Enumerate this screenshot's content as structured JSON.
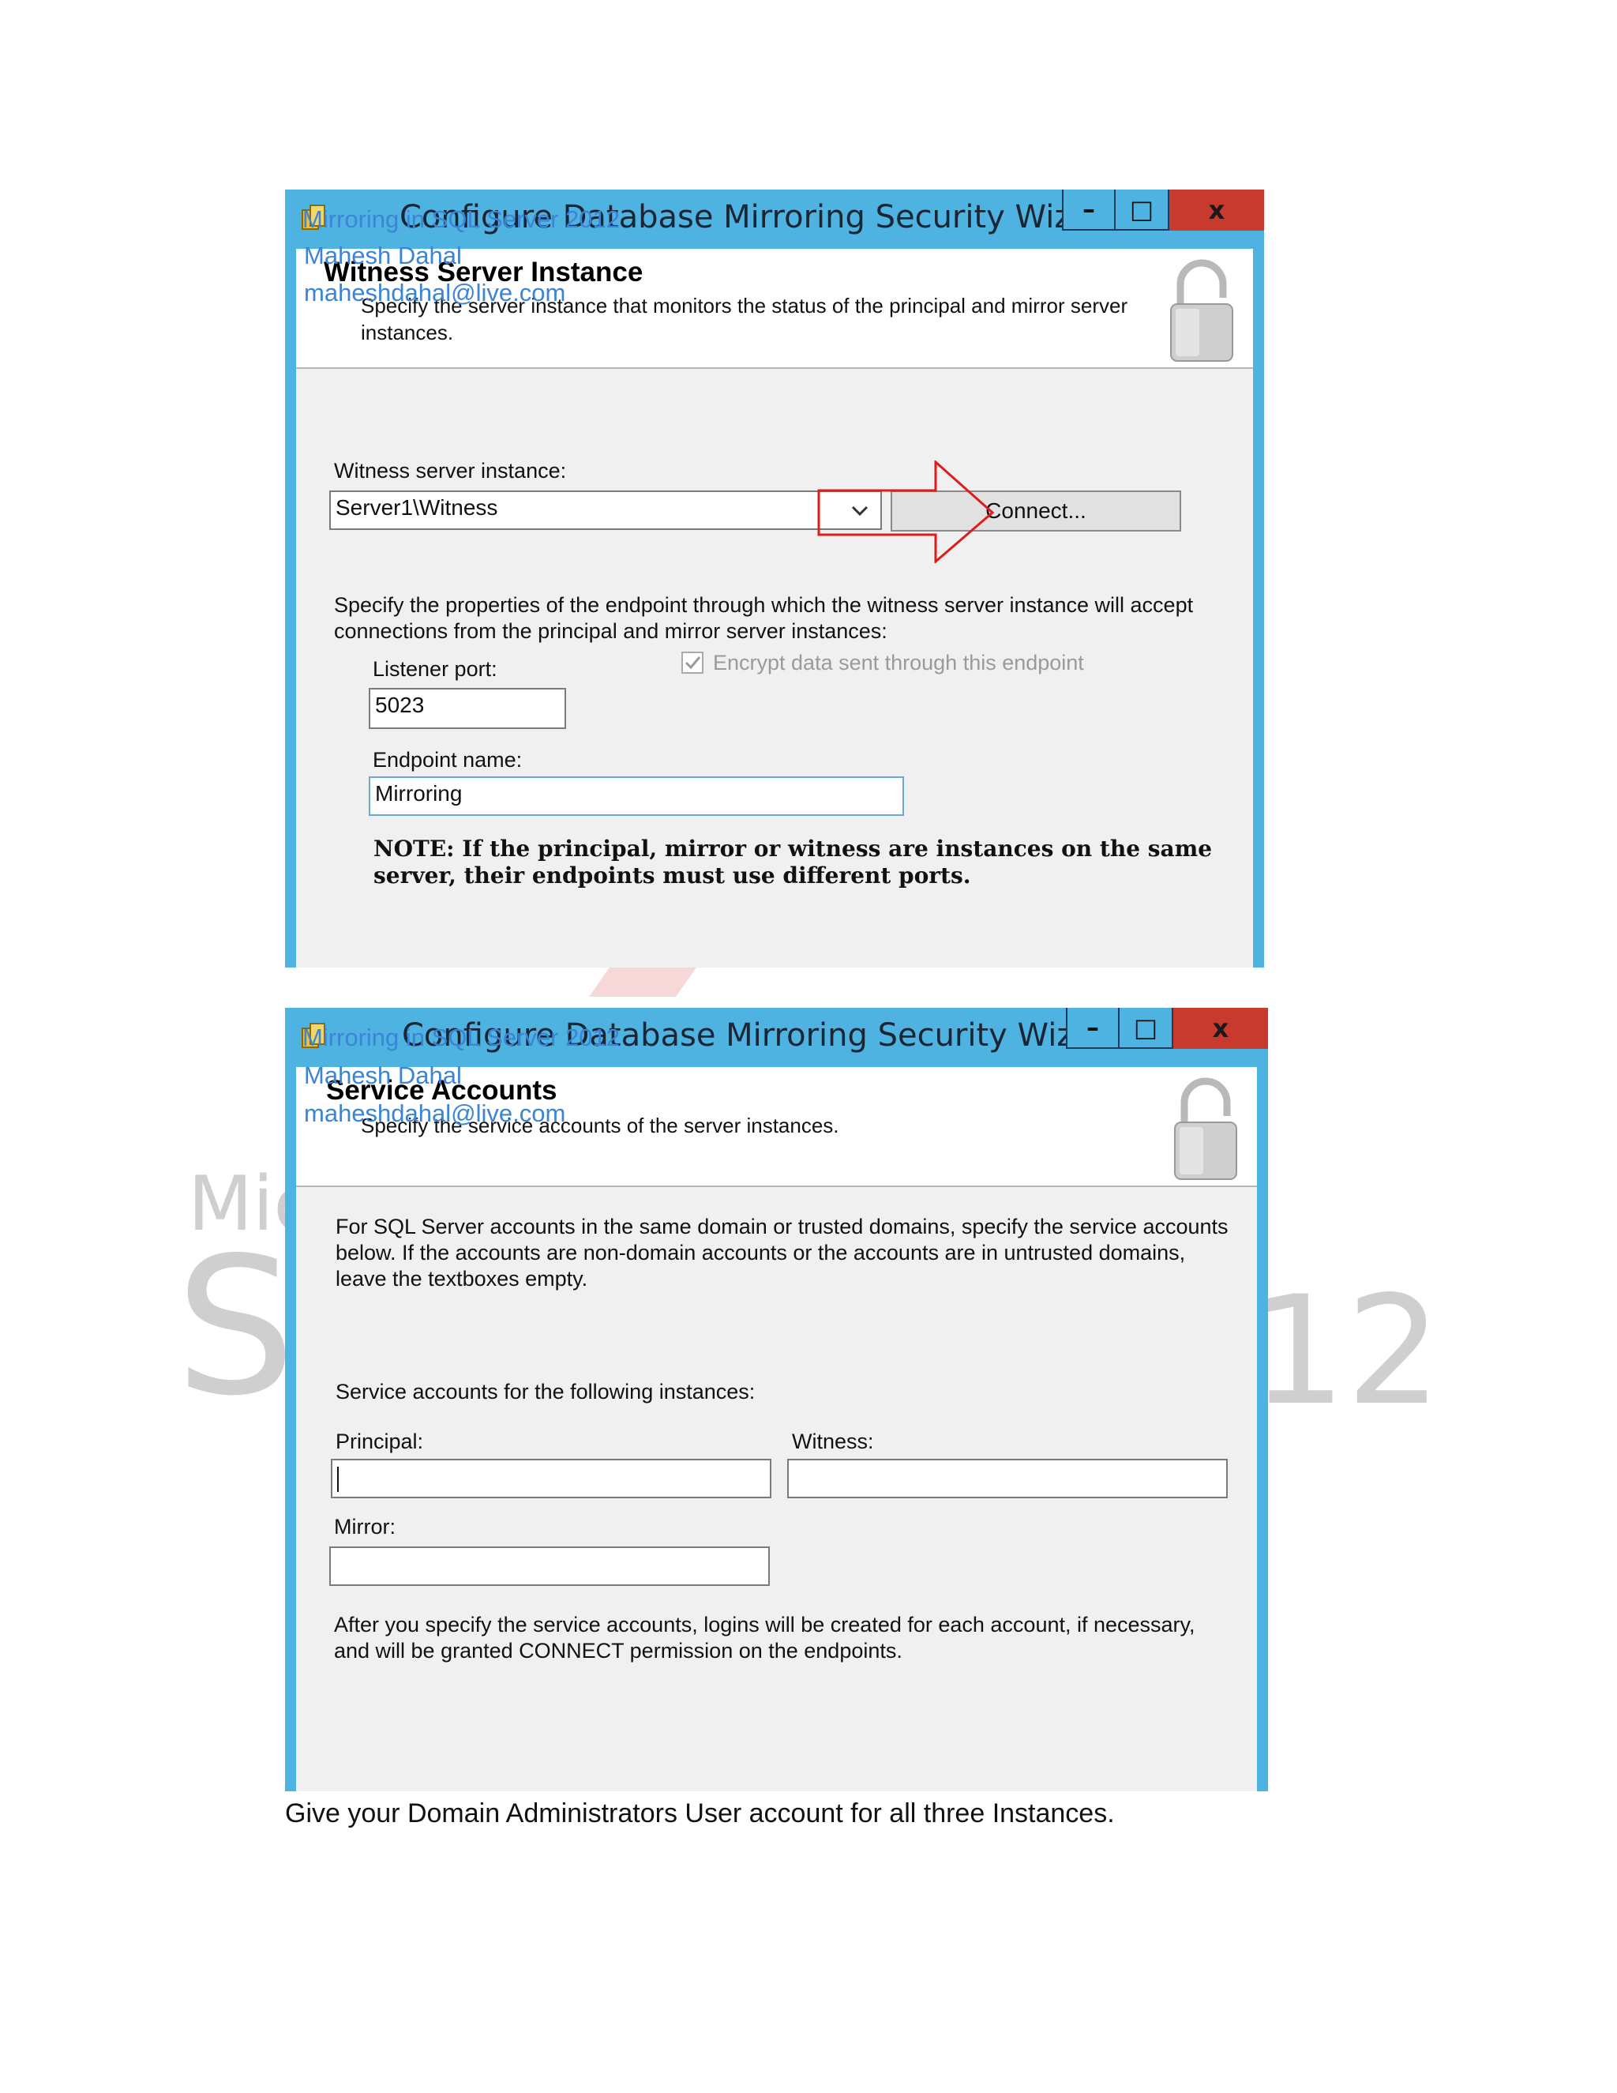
{
  "watermark": {
    "line1": "Mic",
    "line2": "S",
    "line3": "12"
  },
  "dialog1": {
    "title": "Configure Database Mirroring Security Wizard",
    "overlay": {
      "line1": "Mirroring in SQL Server 2012",
      "line2": "Mahesh Dahal",
      "line3": "maheshdahal@live.com"
    },
    "controls": {
      "minimize": "–",
      "maximize": "□",
      "close": "x"
    },
    "header_title": "Witness Server Instance",
    "header_desc": "Specify the server instance that monitors the status of the principal and mirror server instances.",
    "witness_label": "Witness server instance:",
    "witness_value": "Server1\\Witness",
    "connect_label": "Connect...",
    "endpoint_desc": "Specify the properties of the endpoint through which the witness server instance will accept connections from the principal and mirror server instances:",
    "listener_label": "Listener port:",
    "listener_value": "5023",
    "encrypt_label": "Encrypt data sent through this endpoint",
    "encrypt_checked": true,
    "endpoint_label": "Endpoint name:",
    "endpoint_value": "Mirroring",
    "note": "NOTE: If the principal, mirror or witness are instances on the same server, their endpoints must use different ports."
  },
  "dialog2": {
    "title": "Configure Database Mirroring Security Wizard",
    "overlay": {
      "line1": "Mirroring in SQL Server 2012",
      "line2": "Mahesh Dahal",
      "line3": "maheshdahal@live.com"
    },
    "controls": {
      "minimize": "–",
      "maximize": "□",
      "close": "x"
    },
    "header_title": "Service Accounts",
    "header_desc": "Specify the service accounts of the server instances.",
    "intro": "For SQL Server accounts in the same domain or trusted domains, specify the service accounts below. If the accounts are non-domain accounts or the accounts are in untrusted domains, leave the textboxes empty.",
    "instances_label": "Service accounts for the following instances:",
    "principal_label": "Principal:",
    "principal_value": "",
    "witness_label": "Witness:",
    "witness_value": "",
    "mirror_label": "Mirror:",
    "mirror_value": "",
    "footer": "After you specify the service accounts, logins will be created for each account, if necessary, and will be granted CONNECT permission on the endpoints."
  },
  "caption": "Give your Domain Administrators User account for all three Instances.",
  "colors": {
    "window_frame": "#4fb3e2",
    "close_button": "#c83a2e",
    "annotation_arrow": "#e01b1b",
    "overlay_text": "#3b84d6"
  }
}
